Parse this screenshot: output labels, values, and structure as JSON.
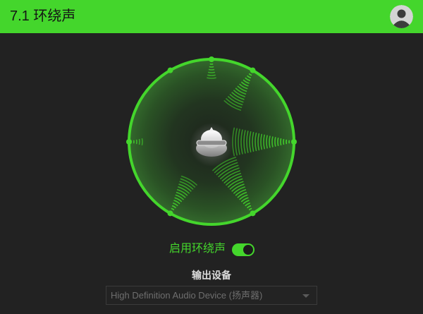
{
  "window": {
    "title": "7.1 环绕声"
  },
  "header": {
    "account_icon": "user-avatar-icon"
  },
  "surround": {
    "toggle_label": "启用环绕声",
    "enabled": true,
    "listener_icon": "listener-head-icon",
    "speaker_icon": "speaker-dot-icon"
  },
  "output": {
    "label": "输出设备",
    "selected_device": "High Definition Audio Device (扬声器)",
    "disabled": true,
    "dropdown_icon": "chevron-down-icon"
  },
  "colors": {
    "accent": "#44d62c",
    "background": "#222222",
    "header_text": "#141414",
    "muted_text": "#6e6e6e"
  }
}
